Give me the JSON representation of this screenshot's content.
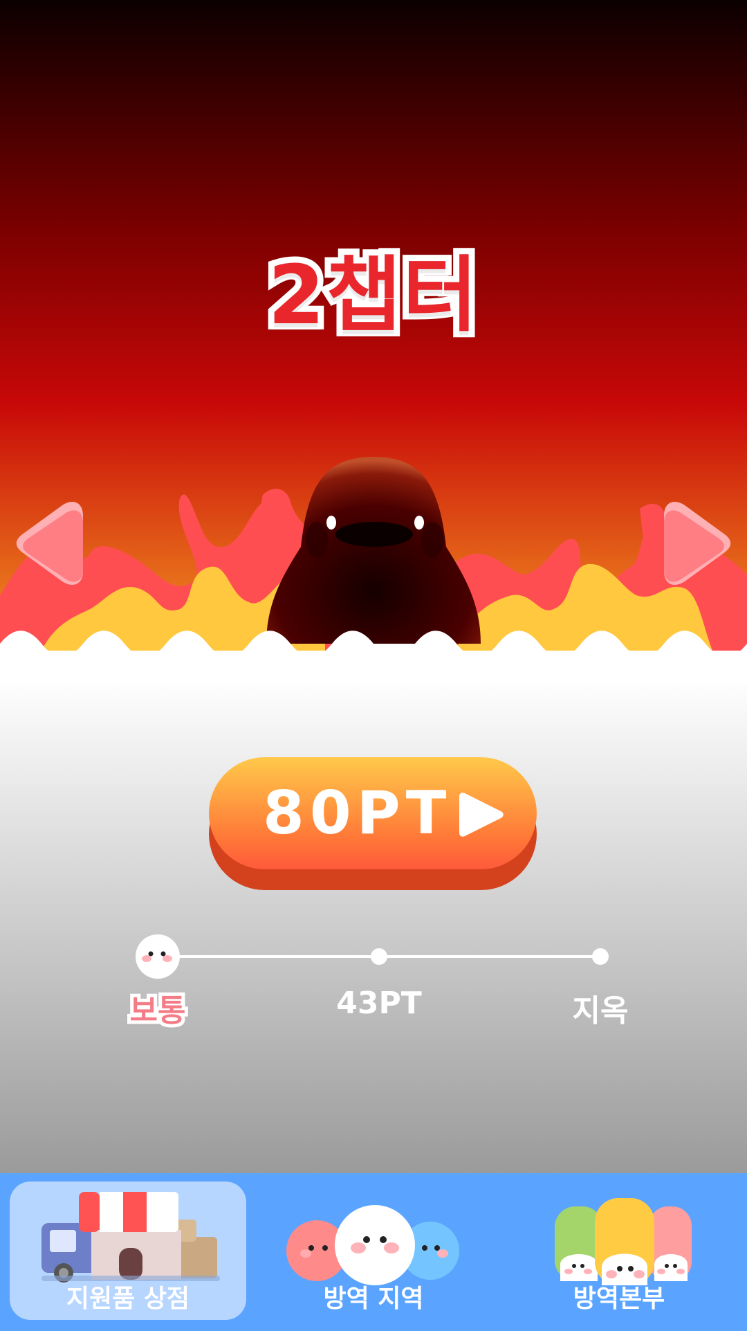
{
  "chapter": {
    "title": "2챕터"
  },
  "play_button": {
    "label": "80PT"
  },
  "difficulty": {
    "steps": [
      {
        "label": "보통",
        "selected": true
      },
      {
        "label": "43PT",
        "selected": false
      },
      {
        "label": "지옥",
        "selected": false
      }
    ]
  },
  "bottom_nav": {
    "tabs": [
      {
        "label": "지원품 상점",
        "icon": "shop-icon",
        "active": true
      },
      {
        "label": "방역 지역",
        "icon": "blob-group-icon",
        "active": false
      },
      {
        "label": "방역본부",
        "icon": "headquarters-icon",
        "active": false
      }
    ]
  },
  "colors": {
    "title_red": "#e8262c",
    "nav_blue": "#5aa4ff",
    "nav_active": "#b6d5ff",
    "play_orange": "#ff7a38",
    "arrow_pink": "#ff7e84"
  }
}
